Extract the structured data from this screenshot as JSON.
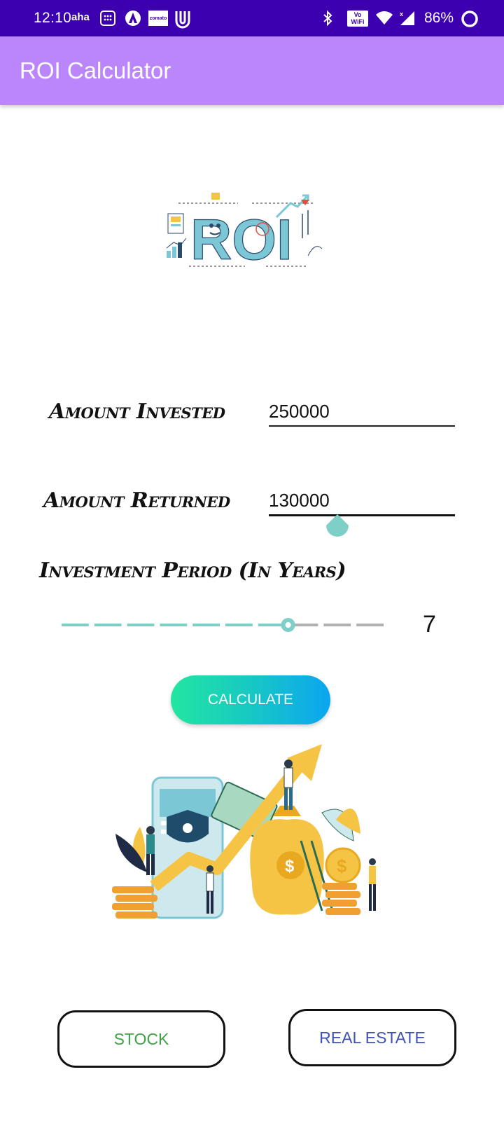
{
  "status_bar": {
    "time": "12:10",
    "left_icons": [
      "aha-icon",
      "keypad-icon",
      "arrow-a-icon",
      "zomato-icon",
      "uj-icon"
    ],
    "left_text": {
      "aha": "aha",
      "zomato": "zomato"
    },
    "right_icons": [
      "bluetooth-icon",
      "vowifi-icon",
      "wifi-icon",
      "signal-icon",
      "battery-icon"
    ],
    "vowifi_text": "Vo WiFi",
    "battery": "86%"
  },
  "app_bar": {
    "title": "ROI Calculator"
  },
  "logo": {
    "text": "ROI"
  },
  "form": {
    "amount_invested_label": "Amount Invested",
    "amount_invested_value": "250000",
    "amount_returned_label": "Amount Returned",
    "amount_returned_value": "130000",
    "period_label": "Investment Period  (In Years)",
    "period_value": "7",
    "period_slider": {
      "min": 0,
      "max": 10,
      "value": 7
    }
  },
  "buttons": {
    "calculate": "CALCULATE",
    "stock": "STOCK",
    "real_estate": "REAL ESTATE"
  },
  "colors": {
    "status_bar": "#3c00b0",
    "app_bar": "#bb86fc",
    "accent": "#7fcfc9",
    "stock_text": "#43a047",
    "real_estate_text": "#3f51b5"
  }
}
